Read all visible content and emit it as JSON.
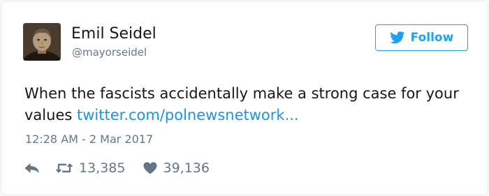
{
  "author": {
    "name": "Emil Seidel",
    "handle": "@mayorseidel",
    "avatar_icon": "portrait-photo"
  },
  "follow": {
    "label": "Follow",
    "icon": "twitter-bird-icon",
    "color": "#1da1f2"
  },
  "tweet": {
    "text": "When the fascists accidentally make a strong case for your values ",
    "link_text": "twitter.com/polnewsnetwork...",
    "link_color": "#1b95e0",
    "timestamp": "12:28 AM - 2 Mar 2017"
  },
  "actions": {
    "reply_icon": "reply-arrow-icon",
    "retweet_icon": "retweet-icon",
    "retweet_count": "13,385",
    "like_icon": "heart-icon",
    "like_count": "39,136"
  },
  "colors": {
    "text": "#14171a",
    "secondary": "#657786",
    "border": "#e1e8ed"
  }
}
